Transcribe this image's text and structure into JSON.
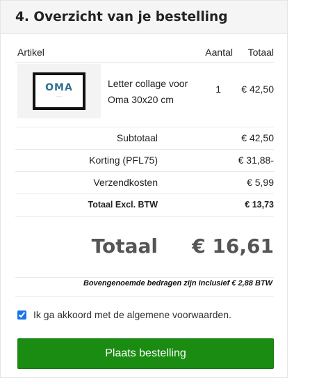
{
  "section": {
    "title": "4. Overzicht van je bestelling"
  },
  "table": {
    "headers": {
      "article": "Artikel",
      "quantity": "Aantal",
      "total": "Totaal"
    },
    "items": [
      {
        "thumbnail_text": "OMA",
        "name": "Letter collage voor Oma 30x20 cm",
        "quantity": "1",
        "price": "€ 42,50"
      }
    ]
  },
  "summary": {
    "subtotal_label": "Subtotaal",
    "subtotal_value": "€ 42,50",
    "discount_label": "Korting (PFL75)",
    "discount_value": "€ 31,88-",
    "shipping_label": "Verzendkosten",
    "shipping_value": "€ 5,99",
    "total_excl_label": "Totaal Excl. BTW",
    "total_excl_value": "€ 13,73",
    "grand_label": "Totaal",
    "grand_value": "€ 16,61",
    "vat_note": "Bovengenoemde bedragen zijn inclusief € 2,88 BTW"
  },
  "terms": {
    "label": "Ik ga akkoord met de algemene voorwaarden.",
    "checked": true
  },
  "submit": {
    "label": "Plaats bestelling"
  },
  "colors": {
    "button": "#1a8c12",
    "header_bg": "#f5f5f5",
    "grand_total_text": "#555555"
  }
}
